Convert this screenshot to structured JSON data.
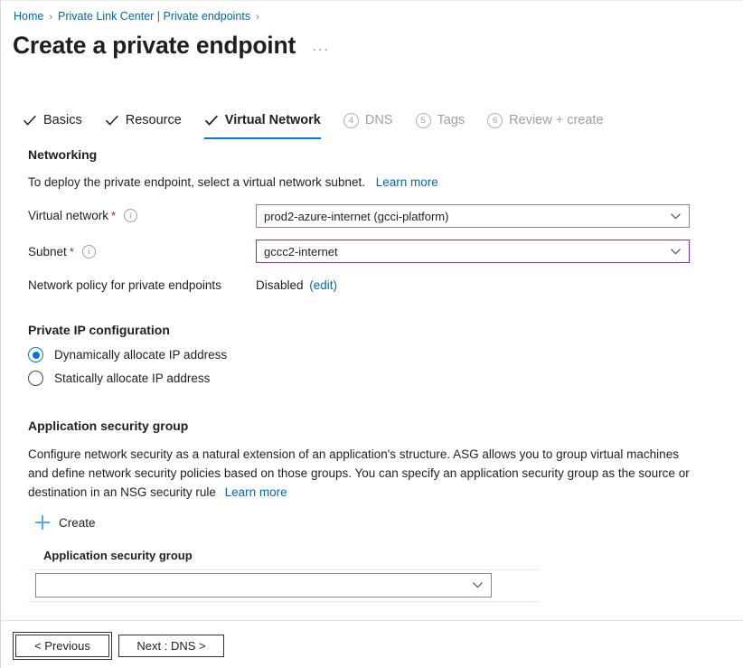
{
  "breadcrumb": {
    "items": [
      {
        "label": "Home"
      },
      {
        "label": "Private Link Center | Private endpoints"
      }
    ],
    "separator": "›"
  },
  "header": {
    "title": "Create a private endpoint",
    "overflow_menu": "···"
  },
  "tabs": [
    {
      "label": "Basics",
      "state": "done",
      "marker": "check"
    },
    {
      "label": "Resource",
      "state": "done",
      "marker": "check"
    },
    {
      "label": "Virtual Network",
      "state": "active",
      "marker": "check"
    },
    {
      "label": "DNS",
      "state": "pending",
      "marker": "4"
    },
    {
      "label": "Tags",
      "state": "pending",
      "marker": "5"
    },
    {
      "label": "Review + create",
      "state": "pending",
      "marker": "6"
    }
  ],
  "networking": {
    "heading": "Networking",
    "description": "To deploy the private endpoint, select a virtual network subnet.",
    "learn_more": "Learn more",
    "virtual_network": {
      "label": "Virtual network",
      "required": "*",
      "value": "prod2-azure-internet (gcci-platform)"
    },
    "subnet": {
      "label": "Subnet",
      "required": "*",
      "value": "gccc2-internet"
    },
    "network_policy": {
      "label": "Network policy for private endpoints",
      "value": "Disabled",
      "edit_link": "(edit)"
    }
  },
  "private_ip": {
    "heading": "Private IP configuration",
    "options": [
      {
        "label": "Dynamically allocate IP address",
        "selected": true
      },
      {
        "label": "Statically allocate IP address",
        "selected": false
      }
    ]
  },
  "asg": {
    "heading": "Application security group",
    "description": "Configure network security as a natural extension of an application's structure. ASG allows you to group virtual machines and define network security policies based on those groups. You can specify an application security group as the source or destination in an NSG security rule",
    "learn_more": "Learn more",
    "create_label": "Create",
    "grid_header": "Application security group",
    "selector_value": ""
  },
  "footer": {
    "previous_label": "< Previous",
    "next_label": "Next : DNS >"
  },
  "colors": {
    "link": "#0067b8",
    "accent": "#0078d4",
    "focus_border": "#8b2fa8",
    "required": "#a4262c",
    "muted": "#a19f9d"
  }
}
